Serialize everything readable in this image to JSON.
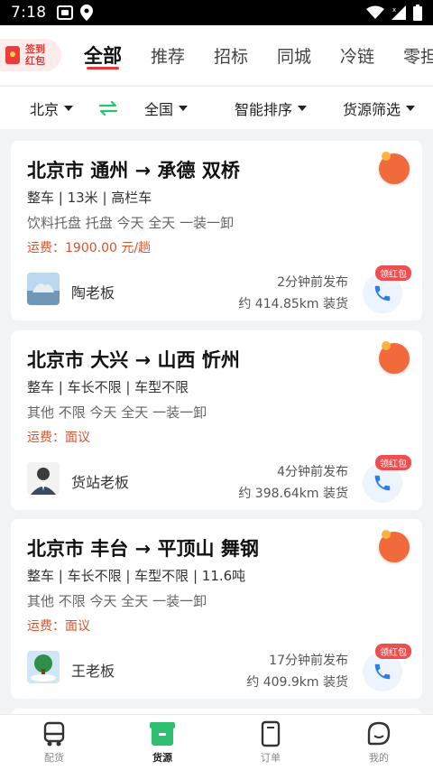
{
  "status_bar": {
    "time": "7:18"
  },
  "checkin": {
    "label": "签到红包"
  },
  "tabs": [
    {
      "label": "全部",
      "active": true
    },
    {
      "label": "推荐",
      "active": false
    },
    {
      "label": "招标",
      "active": false
    },
    {
      "label": "同城",
      "active": false
    },
    {
      "label": "冷链",
      "active": false
    },
    {
      "label": "零担",
      "active": false
    }
  ],
  "filters": {
    "origin": "北京",
    "destination": "全国",
    "sort": "智能排序",
    "cargo_filter": "货源筛选"
  },
  "listings": [
    {
      "route": "北京市 通州 → 承德 双桥",
      "spec": "整车 | 13米 | 高栏车",
      "cargo": "饮料托盘 托盘 今天 全天 一装一卸",
      "fee": "运费：1900.00 元/趟",
      "owner": "陶老板",
      "posted": "2分钟前发布",
      "distance": "约 414.85km 装货",
      "badge": "领红包"
    },
    {
      "route": "北京市 大兴 → 山西 忻州",
      "spec": "整车 | 车长不限 | 车型不限",
      "cargo": "其他 不限 今天 全天 一装一卸",
      "fee": "运费：面议",
      "owner": "货站老板",
      "posted": "4分钟前发布",
      "distance": "约 398.64km 装货",
      "badge": "领红包"
    },
    {
      "route": "北京市 丰台 → 平顶山 舞钢",
      "spec": "整车 | 车长不限 | 车型不限 | 11.6吨",
      "cargo": "其他 不限 今天 全天 一装一卸",
      "fee": "运费：面议",
      "owner": "王老板",
      "posted": "17分钟前发布",
      "distance": "约 409.9km 装货",
      "badge": "领红包"
    }
  ],
  "bottom_nav": [
    {
      "label": "配货",
      "icon": "truck-icon",
      "active": false
    },
    {
      "label": "货源",
      "icon": "cargo-box-icon",
      "active": true
    },
    {
      "label": "订单",
      "icon": "order-icon",
      "active": false
    },
    {
      "label": "我的",
      "icon": "profile-icon",
      "active": false
    }
  ],
  "colors": {
    "accent": "#e53935",
    "fee": "#d9542c",
    "active_nav": "#2fbf71",
    "call": "#2d7ee8"
  }
}
